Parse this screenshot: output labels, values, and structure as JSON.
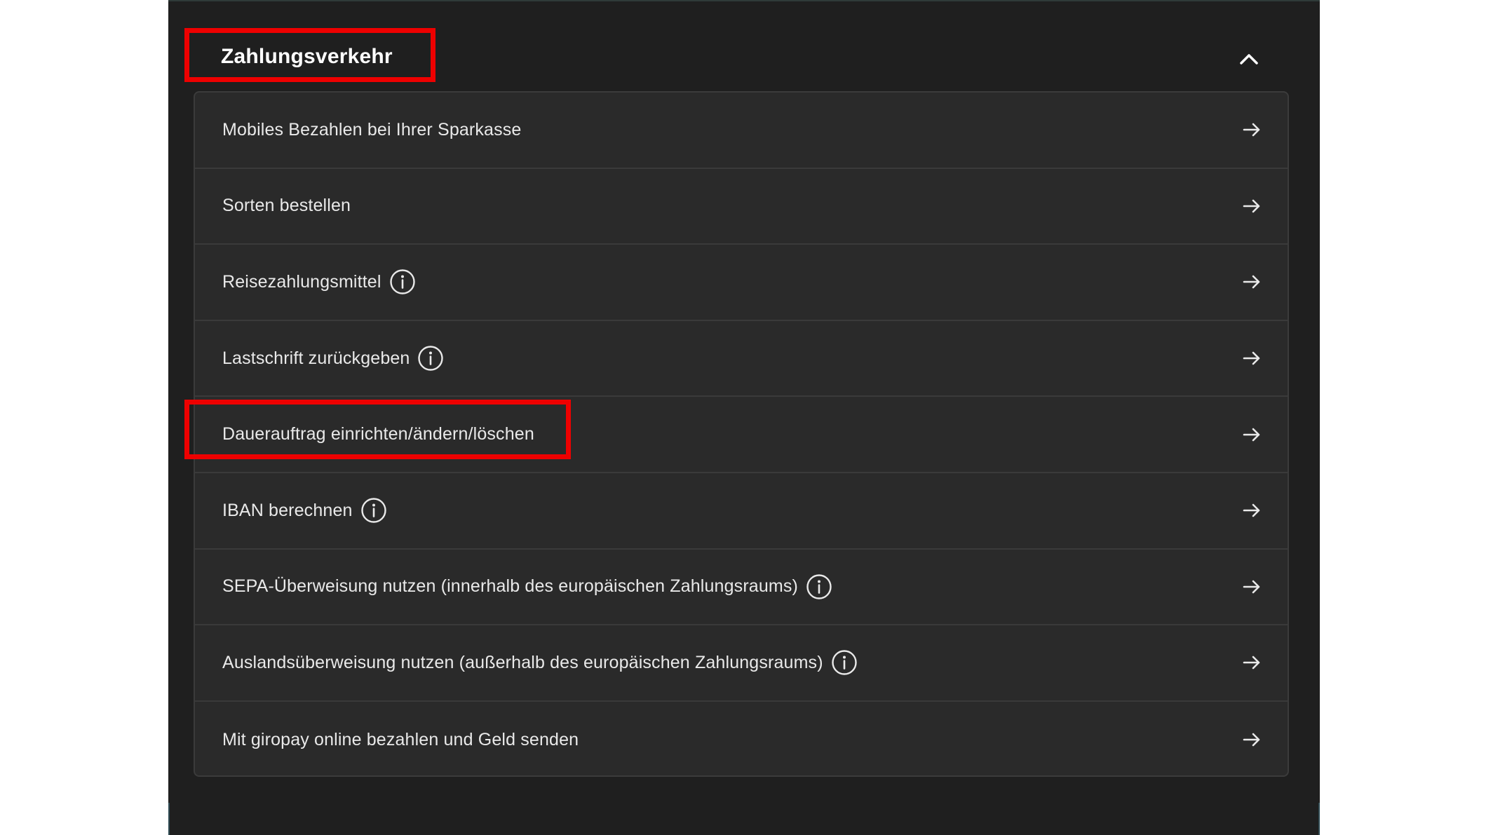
{
  "section": {
    "title": "Zahlungsverkehr",
    "toggle_icon": "chevron-up-icon",
    "expanded": true
  },
  "items": [
    {
      "label": "Mobiles Bezahlen bei Ihrer Sparkasse",
      "info": false,
      "icon": "arrow-right-icon"
    },
    {
      "label": "Sorten bestellen",
      "info": false,
      "icon": "arrow-right-icon"
    },
    {
      "label": "Reisezahlungsmittel",
      "info": true,
      "icon": "arrow-right-icon"
    },
    {
      "label": "Lastschrift zurückgeben",
      "info": true,
      "icon": "arrow-right-icon"
    },
    {
      "label": "Dauerauftrag einrichten/ändern/löschen",
      "info": false,
      "icon": "arrow-right-icon"
    },
    {
      "label": "IBAN berechnen",
      "info": true,
      "icon": "arrow-right-icon"
    },
    {
      "label": "SEPA-Überweisung nutzen (innerhalb des europäischen Zahlungsraums)",
      "info": true,
      "icon": "arrow-right-icon"
    },
    {
      "label": "Auslandsüberweisung nutzen (außerhalb des europäischen Zahlungsraums)",
      "info": true,
      "icon": "arrow-right-icon"
    },
    {
      "label": "Mit giropay online bezahlen und Geld senden",
      "info": false,
      "icon": "arrow-right-icon"
    }
  ],
  "colors": {
    "panel_background": "#1f1f1f",
    "list_background": "#2a2a2a",
    "text": "#e9e9e9",
    "highlight": "#ee0000"
  },
  "highlights": [
    "section-title",
    "item-4"
  ]
}
